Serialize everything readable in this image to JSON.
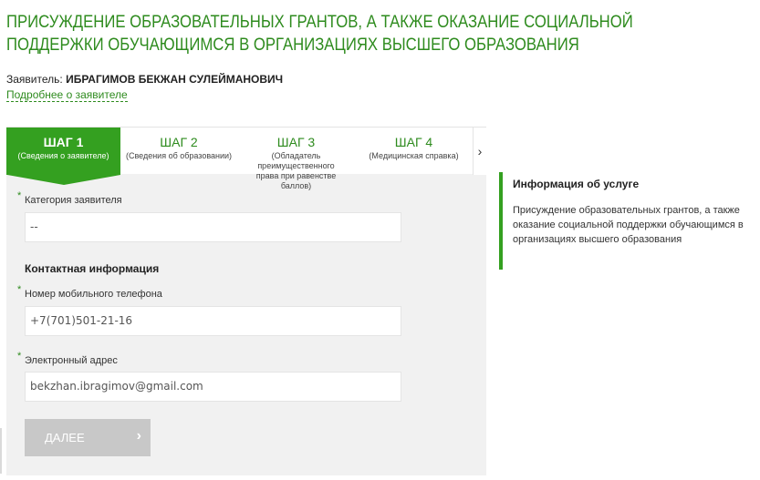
{
  "page": {
    "title": "ПРИСУЖДЕНИЕ ОБРАЗОВАТЕЛЬНЫХ ГРАНТОВ, А ТАКЖЕ ОКАЗАНИЕ СОЦИАЛЬНОЙ ПОДДЕРЖКИ ОБУЧАЮЩИМСЯ В ОРГАНИЗАЦИЯХ ВЫСШЕГО ОБРАЗОВАНИЯ"
  },
  "applicant": {
    "label": "Заявитель:",
    "name": "ИБРАГИМОВ БЕКЖАН СУЛЕЙМАНОВИЧ",
    "details_link": "Подробнее о заявителе"
  },
  "steps": [
    {
      "title": "ШАГ 1",
      "subtitle": "(Сведения о заявителе)"
    },
    {
      "title": "ШАГ 2",
      "subtitle": "(Сведения об образовании)"
    },
    {
      "title": "ШАГ 3",
      "subtitle": "(Обладатель преимущественного права при равенстве баллов)"
    },
    {
      "title": "ШАГ 4",
      "subtitle": "(Медицинская справка)"
    }
  ],
  "steps_next_glyph": "›",
  "form": {
    "required_mark": "*",
    "category": {
      "label": "Категория заявителя",
      "value": "--"
    },
    "contact_section": "Контактная информация",
    "phone": {
      "label": "Номер мобильного телефона",
      "value": "+7(701)501-21-16"
    },
    "email": {
      "label": "Электронный адрес",
      "value": "bekzhan.ibragimov@gmail.com"
    },
    "next_button": {
      "label": "ДАЛЕЕ",
      "glyph": "›"
    }
  },
  "info": {
    "title": "Информация об услуге",
    "text": "Присуждение образовательных грантов, а также оказание социальной поддержки обучающимся в организациях высшего образования"
  },
  "colors": {
    "accent": "#34a020",
    "accent_text": "#2e8b1e",
    "panel_bg": "#f1f1f1",
    "disabled_button": "#c8c8c8"
  }
}
